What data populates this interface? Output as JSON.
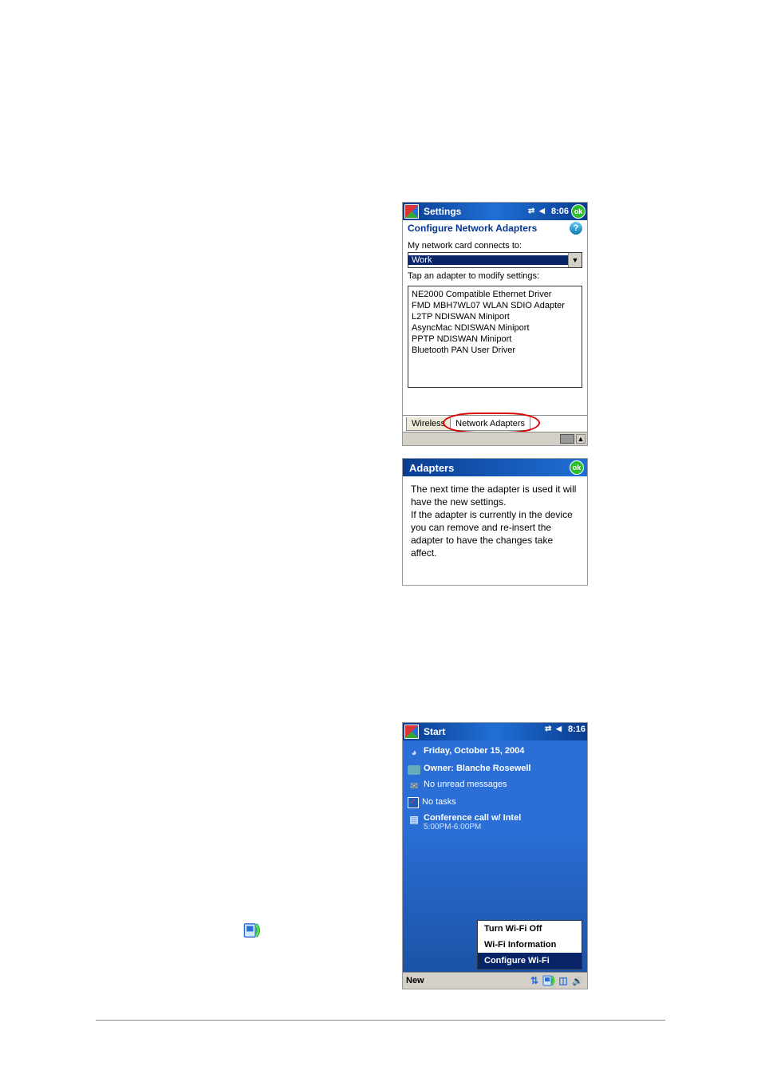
{
  "ss1": {
    "title": "Settings",
    "clock": "8:06",
    "ok": "ok",
    "heading": "Configure Network Adapters",
    "label_connects": "My network card connects to:",
    "dropdown_value": "Work",
    "label_tap": "Tap an adapter to modify settings:",
    "adapters": [
      "NE2000 Compatible Ethernet Driver",
      "FMD MBH7WL07 WLAN SDIO Adapter",
      "L2TP NDISWAN Miniport",
      "AsyncMac NDISWAN Miniport",
      "PPTP NDISWAN Miniport",
      "Bluetooth PAN User Driver"
    ],
    "tab_wireless": "Wireless",
    "tab_network_adapters": "Network Adapters"
  },
  "ss2": {
    "title": "Adapters",
    "ok": "ok",
    "message": "The next time the adapter is used it will have the new settings.\nIf the adapter is currently in the device you can remove and re-insert the adapter to have the changes take affect."
  },
  "ss3": {
    "title": "Start",
    "clock": "8:16",
    "date": "Friday, October 15, 2004",
    "owner": "Owner: Blanche Rosewell",
    "messages": "No unread messages",
    "tasks": "No tasks",
    "appt_title": "Conference call w/ Intel",
    "appt_time": "5:00PM-6:00PM",
    "menu": {
      "off": "Turn Wi-Fi Off",
      "info": "Wi-Fi Information",
      "conf": "Configure Wi-Fi"
    },
    "new": "New"
  }
}
